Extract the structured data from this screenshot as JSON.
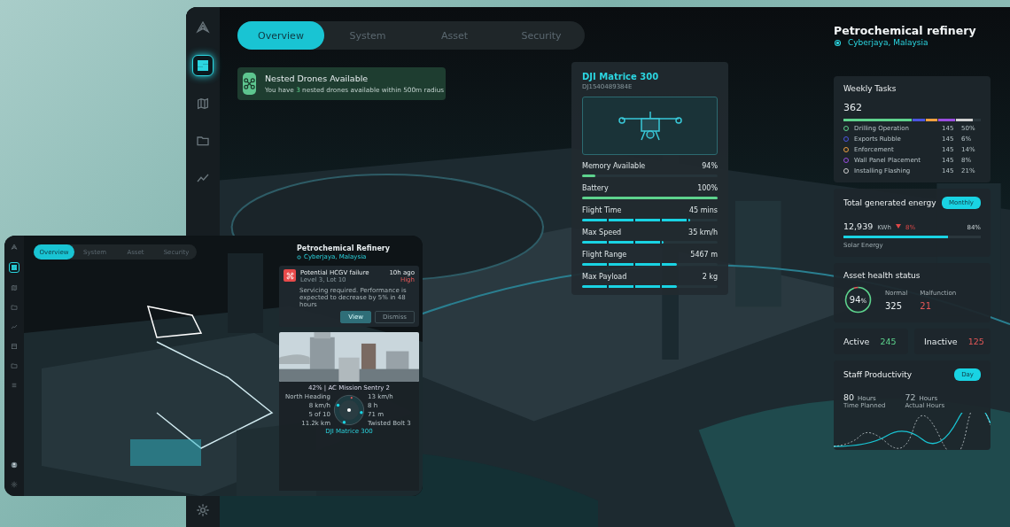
{
  "main": {
    "sidebar": [
      {
        "kind": "logo",
        "selected": false
      },
      {
        "kind": "dashboard",
        "selected": true
      },
      {
        "kind": "map",
        "selected": false
      },
      {
        "kind": "folder",
        "selected": false
      },
      {
        "kind": "trend",
        "selected": false
      },
      {
        "kind": "settings",
        "selected": false
      }
    ],
    "tabs": [
      {
        "label": "Overview",
        "selected": true
      },
      {
        "label": "System",
        "selected": false
      },
      {
        "label": "Asset",
        "selected": false
      },
      {
        "label": "Security",
        "selected": false
      }
    ],
    "notification": {
      "title": "Nested Drones Available",
      "text_before": "You have ",
      "count": "3",
      "text_after": " nested drones available within 500m radius"
    },
    "drone": {
      "name": "DJI Matrice 300",
      "serial": "DJ1540489384E",
      "stats": [
        {
          "label": "Memory Available",
          "value": "94%",
          "level": 0.1,
          "kind": "solid"
        },
        {
          "label": "Battery",
          "value": "100%",
          "level": 1,
          "kind": "solid"
        },
        {
          "label": "Flight Time",
          "value": "45 mins",
          "level": 0.8,
          "kind": "segmented"
        },
        {
          "label": "Max Speed",
          "value": "35 km/h",
          "level": 0.6,
          "kind": "segmented"
        },
        {
          "label": "Flight Range",
          "value": "5467 m",
          "level": 0.7,
          "kind": "segmented"
        },
        {
          "label": "Max Payload",
          "value": "2 kg",
          "level": 0.7,
          "kind": "segmented"
        }
      ]
    },
    "site": {
      "title": "Petrochemical refinery",
      "location": "Cyberjaya, Malaysia"
    },
    "weekly_tasks": {
      "title": "Weekly Tasks",
      "total": "362",
      "tasks": [
        {
          "name": "Drilling Operation",
          "count": "145",
          "percent": "50%",
          "color": "#5fd38d",
          "level": 0.5
        },
        {
          "name": "Exports Rubble",
          "count": "145",
          "percent": "6%",
          "color": "#4b55e0",
          "level": 0.1
        },
        {
          "name": "Enforcement",
          "count": "145",
          "percent": "14%",
          "color": "#f0a040",
          "level": 0.09
        },
        {
          "name": "Wall Panel Placement",
          "count": "145",
          "percent": "8%",
          "color": "#9a4de0",
          "level": 0.13
        },
        {
          "name": "Installing Flashing",
          "count": "145",
          "percent": "21%",
          "color": "#d0d0d0",
          "level": 0.13
        }
      ]
    },
    "energy": {
      "title": "Total generated energy",
      "period": "Monthly",
      "value": "12,939",
      "unit": "KWh",
      "change": "8%",
      "percent": "84%",
      "level": 0.76,
      "caption": "Solar Energy"
    },
    "asset_health": {
      "title": "Asset health status",
      "percent": "94",
      "percent_unit": "%",
      "level": 0.94,
      "normal_label": "Normal",
      "normal": "325",
      "malfunction_label": "Malfunction",
      "malfunction": "21"
    },
    "activity": [
      {
        "label": "Active",
        "value": "245",
        "kind": "good"
      },
      {
        "label": "Inactive",
        "value": "125",
        "kind": "bad"
      }
    ],
    "productivity": {
      "title": "Staff Productivity",
      "period": "Day",
      "planned": "80",
      "planned_unit": "Hours",
      "planned_label": "Time Planned",
      "actual": "72",
      "actual_unit": "Hours",
      "actual_label": "Actual Hours"
    }
  },
  "inset": {
    "sidebar": [
      {
        "kind": "logo",
        "selected": false
      },
      {
        "kind": "dashboard",
        "selected": true
      },
      {
        "kind": "map",
        "selected": false
      },
      {
        "kind": "folder",
        "selected": false
      },
      {
        "kind": "trend",
        "selected": false
      },
      {
        "kind": "calendar",
        "selected": false
      },
      {
        "kind": "folder",
        "selected": false
      },
      {
        "kind": "list",
        "selected": false
      },
      {
        "kind": "avatar",
        "selected": false
      },
      {
        "kind": "settings",
        "selected": false
      }
    ],
    "tabs": [
      {
        "label": "Overview",
        "selected": true
      },
      {
        "label": "System",
        "selected": false
      },
      {
        "label": "Asset",
        "selected": false
      },
      {
        "label": "Security",
        "selected": false
      }
    ],
    "site": {
      "title": "Petrochemical Refinery",
      "location": "Cyberjaya, Malaysia"
    },
    "alert": {
      "title": "Potential HCGV failure",
      "subtitle": "Level 3, Lot 10",
      "time": "10h ago",
      "severity": "High",
      "text": "Servicing required. Performance is expected to decrease by 5% in 48 hours",
      "buttons": [
        {
          "label": "View",
          "kind": "primary"
        },
        {
          "label": "Dismiss",
          "kind": "secondary"
        }
      ]
    },
    "mission": {
      "title": "42% | AC Mission Sentry 2",
      "left": [
        "North Heading",
        "8 km/h",
        "5 of 10",
        "11.2k km"
      ],
      "right": [
        "13 km/h",
        "8 h",
        "71 m",
        "Twisted Bolt 3"
      ],
      "drone": "DJI Matrice 300"
    }
  }
}
